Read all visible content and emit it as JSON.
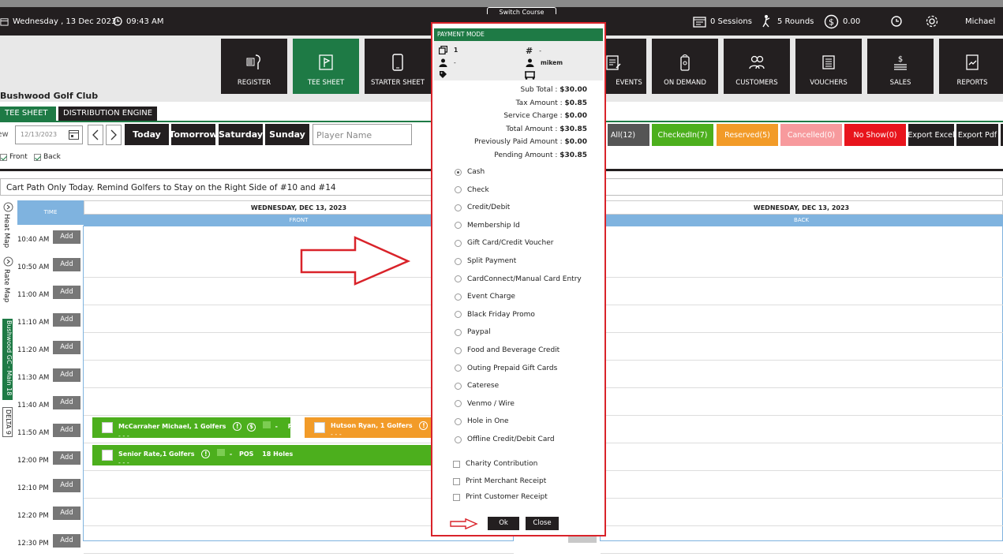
{
  "topbar": {
    "date": "Wednesday , 13 Dec 2023",
    "time": "09:43 AM",
    "switch_course": "Switch Course",
    "sessions": "0 Sessions",
    "rounds": "5 Rounds",
    "balance": "0.00",
    "user": "Michael"
  },
  "nav": {
    "register": "REGISTER",
    "tee_sheet": "TEE SHEET",
    "starter_sheet": "STARTER SHEET",
    "events": "EVENTS",
    "on_demand": "ON DEMAND",
    "customers": "CUSTOMERS",
    "vouchers": "VOUCHERS",
    "sales": "SALES",
    "reports": "REPORTS"
  },
  "club": "Bushwood Golf Club",
  "tabs": {
    "tee_sheet": "TEE SHEET",
    "distribution": "DISTRIBUTION ENGINE"
  },
  "toolbar": {
    "view": "View",
    "date_value": "12/13/2023",
    "today": "Today",
    "tomorrow": "Tomorrow",
    "saturday": "Saturday",
    "sunday": "Sunday",
    "player_placeholder": "Player Name",
    "all": "All(12)",
    "checkedin": "CheckedIn(7)",
    "reserved": "Reserved(5)",
    "cancelled": "Cancelled(0)",
    "noshow": "No Show(0)",
    "export_excel": "Export Excel",
    "export_pdf": "Export Pdf",
    "front": "Front",
    "back": "Back"
  },
  "notice": "Cart Path Only Today.  Remind Golfers to Stay on the Right Side of #10 and #14",
  "sidebar": {
    "heat_map": "Heat Map",
    "rate_map": "Rate Map",
    "course": "Bushwood GC - Main 18",
    "delta": "DELTA 9"
  },
  "grid": {
    "time_header": "TIME",
    "front_day": "WEDNESDAY, DEC 13, 2023",
    "front_label": "FRONT",
    "back_day": "WEDNESDAY, DEC 13, 2023",
    "back_label": "BACK",
    "add": "Add",
    "times": [
      "10:40 AM",
      "10:50 AM",
      "11:00 AM",
      "11:10 AM",
      "11:20 AM",
      "11:30 AM",
      "11:40 AM",
      "11:50 AM",
      "12:00 PM",
      "12:10 PM",
      "12:20 PM",
      "12:30 PM"
    ]
  },
  "bookings": {
    "b1_name": "McCarraher Michael, 1 Golfers",
    "b1_tag": "POS",
    "b1_dash": "-",
    "b1_sub": "- - -",
    "b2_name": "Hutson Ryan, 1 Golfers",
    "b2_sub": "- - -",
    "b3_name": "Senior Rate,1 Golfers",
    "b3_tag": "POS",
    "b3_holes": "18 Holes",
    "b3_dash": "-",
    "b3_sub": "- - -"
  },
  "modal": {
    "title": "PAYMENT MODE",
    "info_count": "1",
    "info_hash": "-",
    "info_person": "-",
    "info_user": "mikem",
    "totals": [
      {
        "label": "Sub Total :",
        "value": "$30.00"
      },
      {
        "label": "Tax Amount :",
        "value": "$0.85"
      },
      {
        "label": "Service Charge :",
        "value": "$0.00"
      },
      {
        "label": "Total Amount :",
        "value": "$30.85"
      },
      {
        "label": "Previously Paid Amount :",
        "value": "$0.00"
      },
      {
        "label": "Pending Amount :",
        "value": "$30.85"
      }
    ],
    "options": [
      "Cash",
      "Check",
      "Credit/Debit",
      "Membership Id",
      "Gift Card/Credit Voucher",
      "Split Payment",
      "CardConnect/Manual Card Entry",
      "Event Charge",
      "Black Friday Promo",
      "Paypal",
      "Food and Beverage Credit",
      "Outing Prepaid Gift Cards",
      "Caterese",
      "Venmo / Wire",
      "Hole in One",
      "Offline Credit/Debit Card"
    ],
    "selected": "Cash",
    "checkboxes": [
      "Charity Contribution",
      "Print Merchant Receipt",
      "Print Customer Receipt"
    ],
    "ok": "Ok",
    "close": "Close"
  },
  "colors": {
    "dark": "#231f20",
    "green": "#1e7a45",
    "booking_green": "#4caf1d",
    "reserved_orange": "#f29b28",
    "cancelled_pink": "#f79a9d",
    "noshow_red": "#e8141c",
    "annotation_red": "#d9232a",
    "header_blue": "#7fb3df"
  }
}
